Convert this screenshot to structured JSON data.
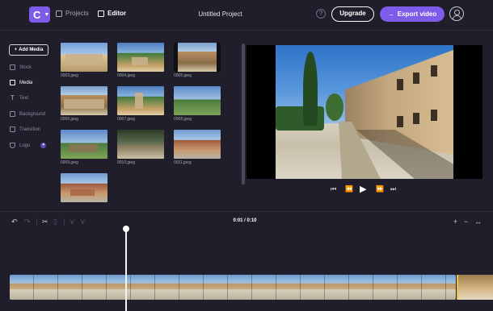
{
  "header": {
    "logo_letter": "C",
    "projects_label": "Projects",
    "editor_label": "Editor",
    "project_title": "Untitled Project",
    "help_glyph": "?",
    "upgrade_label": "Upgrade",
    "export_label": "Export video"
  },
  "sidebar": {
    "add_media_label": "Add Media",
    "items": [
      {
        "label": "Stock",
        "icon": "film-icon"
      },
      {
        "label": "Media",
        "icon": "file-icon"
      },
      {
        "label": "Text",
        "icon": "text-icon"
      },
      {
        "label": "Background",
        "icon": "layers-icon"
      },
      {
        "label": "Transition",
        "icon": "transition-icon"
      },
      {
        "label": "Logo",
        "icon": "shield-icon",
        "badge": "✦"
      }
    ]
  },
  "media": {
    "files": [
      "0003.jpeg",
      "0004.jpeg",
      "0005.jpeg",
      "0006.jpeg",
      "0007.jpeg",
      "0008.jpeg",
      "0009.jpeg",
      "0010.jpeg",
      "0011.jpeg",
      ""
    ]
  },
  "player": {
    "buttons": [
      "skip-back-icon",
      "rewind-icon",
      "play-icon",
      "fast-forward-icon",
      "skip-forward-icon"
    ]
  },
  "timeline": {
    "timecode": "0:01 / 0:10"
  },
  "colors": {
    "accent": "#7c5ce8",
    "background": "#1f1e2a"
  }
}
